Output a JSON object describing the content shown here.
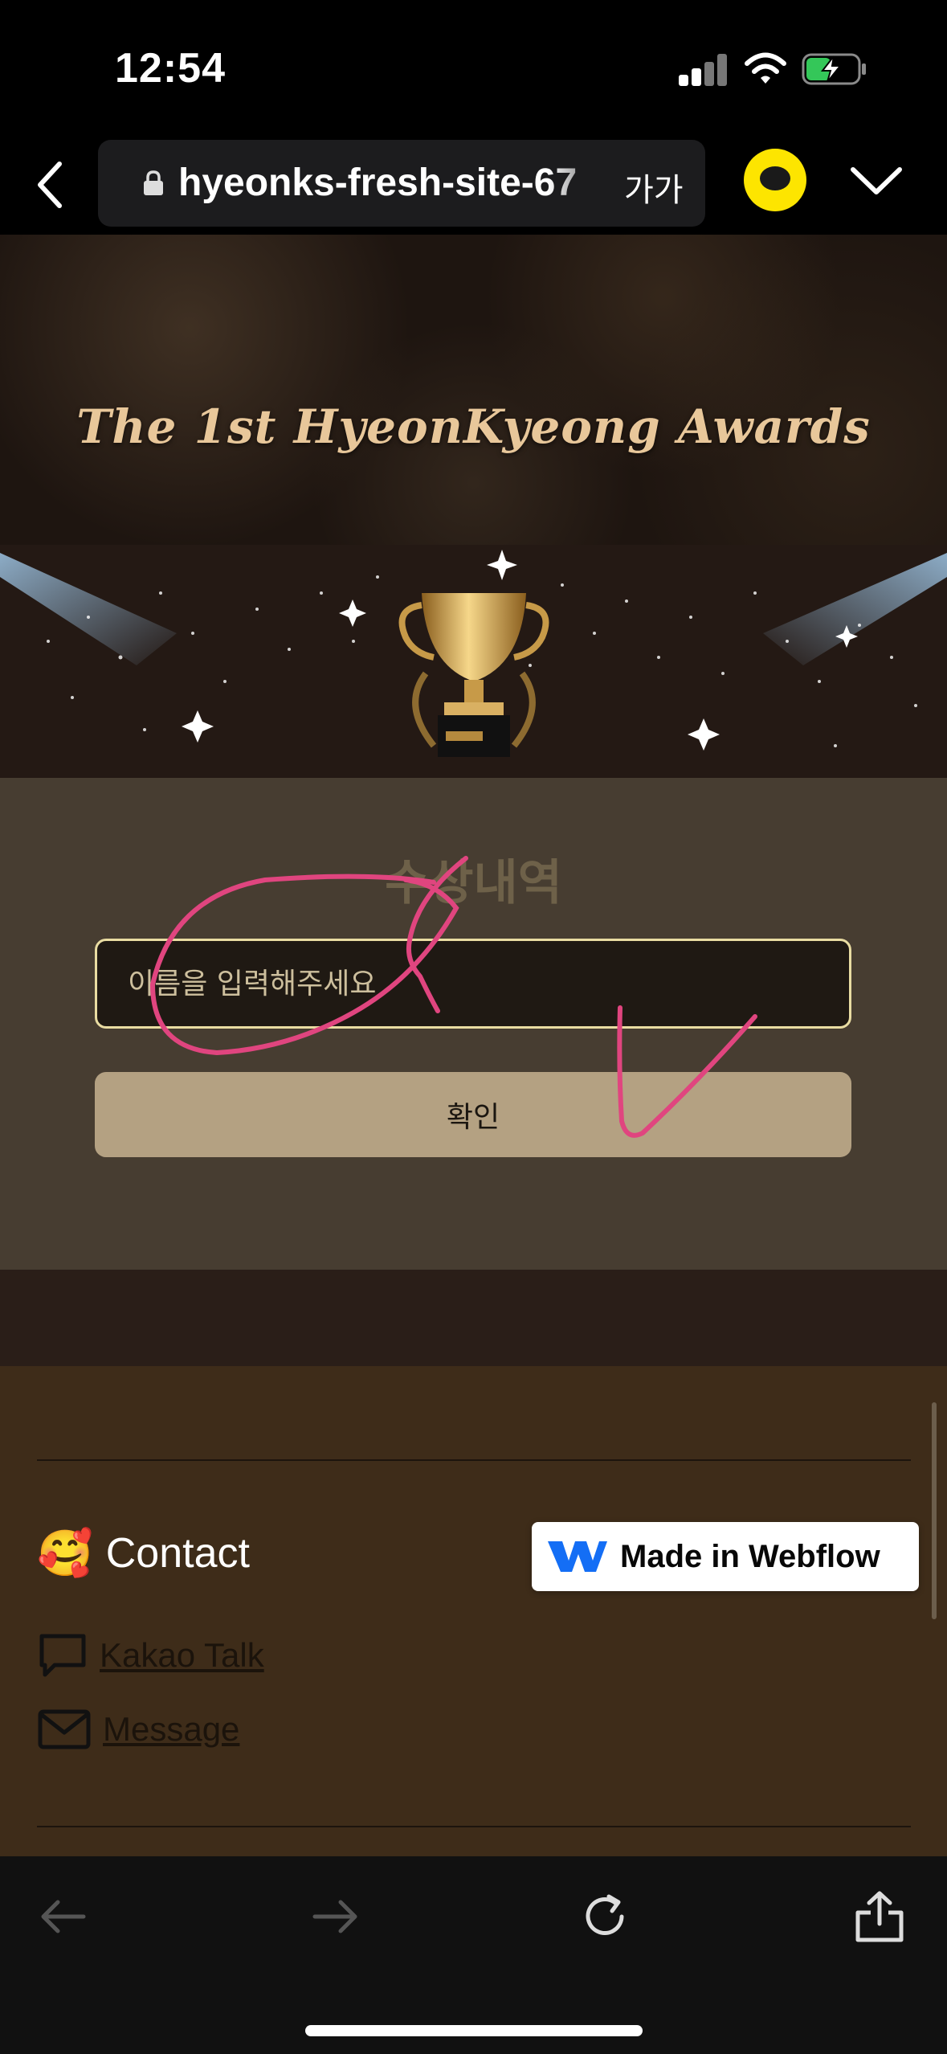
{
  "status_bar": {
    "time": "12:54"
  },
  "browser": {
    "url": "hyeonks-fresh-site-67",
    "text_size_label": "가가"
  },
  "hero": {
    "title": "The 1st HyeonKyeong Awards"
  },
  "awards": {
    "section_title": "수상내역",
    "name_placeholder": "이름을 입력해주세요",
    "confirm_label": "확인"
  },
  "footer": {
    "contact_heading": "Contact",
    "contact_emoji": "🥰",
    "links": [
      {
        "label": "Kakao Talk",
        "icon": "chat-bubble-icon"
      },
      {
        "label": "Message",
        "icon": "envelope-icon"
      }
    ]
  },
  "badge": {
    "label": "Made in Webflow"
  },
  "colors": {
    "accent_gold": "#e8c79a",
    "button_tan": "#b4a182",
    "annotation_pink": "#e0457f",
    "kakao_yellow": "#fde500"
  }
}
